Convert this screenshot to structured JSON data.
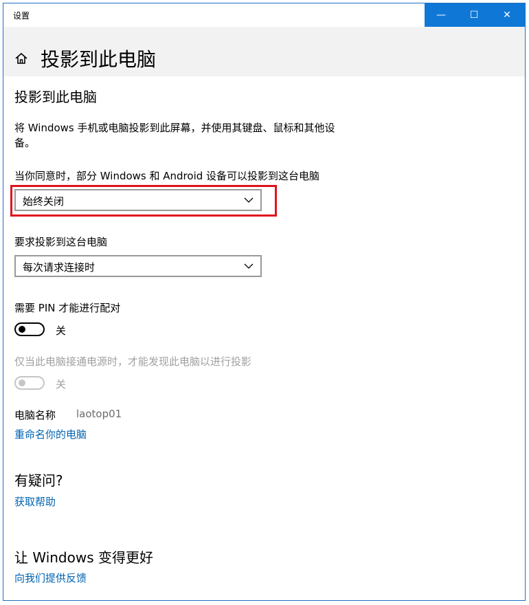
{
  "window": {
    "title": "设置",
    "minimize_glyph": "—",
    "maximize_glyph": "☐",
    "close_glyph": "✕"
  },
  "header": {
    "home_icon": "home-icon",
    "page_title": "投影到此电脑"
  },
  "main": {
    "section_title": "投影到此电脑",
    "description": "将 Windows 手机或电脑投影到此屏幕，并使用其键盘、鼠标和其他设备。",
    "projection_permission": {
      "label": "当你同意时，部分 Windows 和 Android 设备可以投影到这台电脑",
      "selected": "始终关闭"
    },
    "ask_to_project": {
      "label": "要求投影到这台电脑",
      "selected": "每次请求连接时"
    },
    "require_pin": {
      "label": "需要 PIN 才能进行配对",
      "state_label": "关",
      "on": false
    },
    "power_only": {
      "label": "仅当此电脑接通电源时，才能发现此电脑以进行投影",
      "state_label": "关",
      "on": false,
      "disabled": true
    },
    "pc_name": {
      "label": "电脑名称",
      "value": "laotop01",
      "rename_link": "重命名你的电脑"
    },
    "questions": {
      "title": "有疑问?",
      "help_link": "获取帮助"
    },
    "feedback": {
      "title": "让 Windows 变得更好",
      "feedback_link": "向我们提供反馈"
    }
  },
  "colors": {
    "accent": "#0f78d6",
    "link": "#0063b1",
    "highlight": "#e0121b"
  }
}
